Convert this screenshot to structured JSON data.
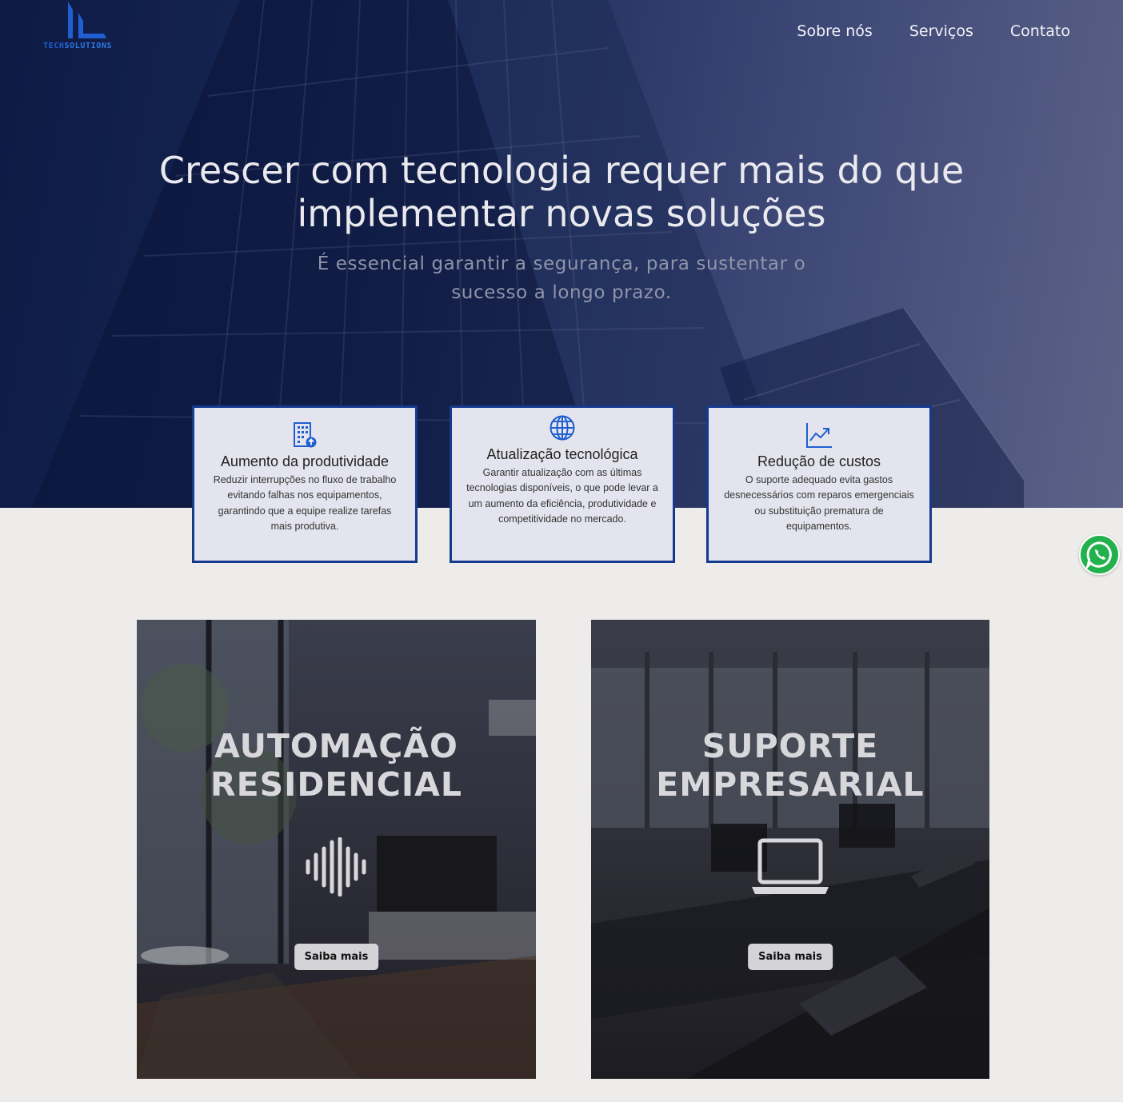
{
  "brand": {
    "logo_tech": "TECH",
    "logo_solutions": "SOLUTIONS"
  },
  "nav": {
    "items": [
      "Sobre nós",
      "Serviços",
      "Contato"
    ]
  },
  "hero": {
    "title": "Crescer com tecnologia requer mais do que implementar novas soluções",
    "subtitle": "É essencial garantir a segurança, para sustentar o sucesso a longo prazo."
  },
  "features": [
    {
      "icon": "building-icon",
      "title": "Aumento da produtividade",
      "text": "Reduzir interrupções no fluxo de trabalho evitando falhas nos equipamentos, garantindo que a equipe realize tarefas mais produtiva."
    },
    {
      "icon": "globe-icon",
      "title": "Atualização tecnológica",
      "text": "Garantir atualização com as últimas tecnologias disponíveis, o que pode levar a um aumento da eficiência, produtividade e competitividade no mercado."
    },
    {
      "icon": "chart-trend-icon",
      "title": "Redução de custos",
      "text": "O suporte adequado evita gastos desnecessários com reparos emergenciais ou substituição prematura de equipamentos."
    }
  ],
  "services": [
    {
      "title_line1": "AUTOMAÇÃO",
      "title_line2": "RESIDENCIAL",
      "icon": "sound-wave-icon",
      "button": "Saiba mais"
    },
    {
      "title_line1": "SUPORTE",
      "title_line2": "EMPRESARIAL",
      "icon": "laptop-icon",
      "button": "Saiba mais"
    }
  ],
  "whatsapp": {
    "icon": "whatsapp-icon"
  },
  "colors": {
    "accent": "#14398d",
    "hero_dark": "#0c1a44",
    "card_bg": "#e4e4ee",
    "page_bg": "#edecea",
    "whatsapp": "#22b14c"
  }
}
